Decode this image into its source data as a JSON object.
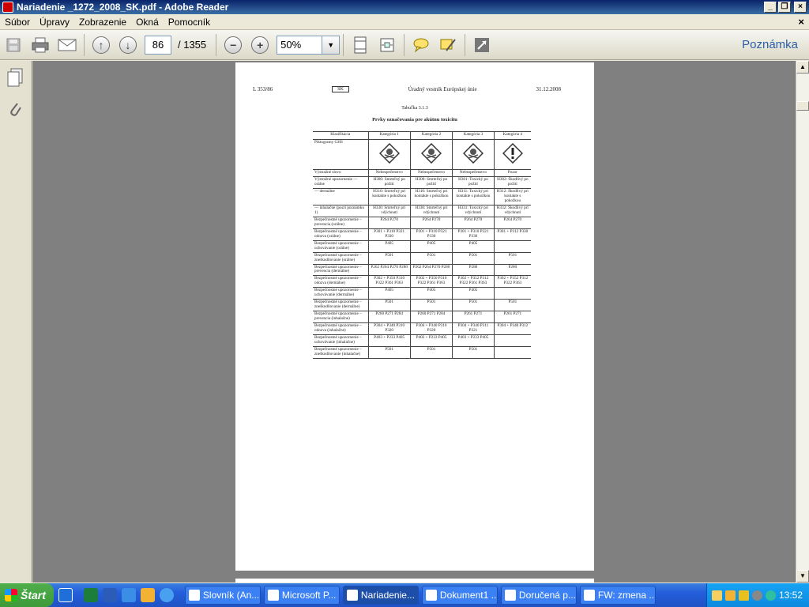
{
  "window": {
    "title": "Nariadenie _1272_2008_SK.pdf - Adobe Reader"
  },
  "menu": {
    "items": [
      "Súbor",
      "Úpravy",
      "Zobrazenie",
      "Okná",
      "Pomocník"
    ],
    "close": "×"
  },
  "toolbar": {
    "page_current": "86",
    "page_total": "/ 1355",
    "zoom": "50%",
    "zoom_dropdown": "▼",
    "comment_label": "Poznámka"
  },
  "doc": {
    "header_left": "L 353/86",
    "header_lang": "SK",
    "header_center": "Úradný vestník Európskej únie",
    "header_right": "31.12.2008",
    "table_title": "Tabuľka 3.1.3",
    "table_subtitle": "Prvky označovania pre akútnu toxicitu",
    "columns": [
      "Klasifikácia",
      "Kategória 1",
      "Kategória 2",
      "Kategória 3",
      "Kategória 4"
    ],
    "rows": [
      {
        "label": "Piktogramy GHS",
        "cells": [
          "skull",
          "skull",
          "skull",
          "excl"
        ]
      },
      {
        "label": "Výstražné slovo",
        "cells": [
          "Nebezpečenstvo",
          "Nebezpečenstvo",
          "Nebezpečenstvo",
          "Pozor"
        ]
      },
      {
        "label": "Výstražné upozornenie — orálne",
        "cells": [
          "H300: Smrteľný po požití",
          "H300: Smrteľný po požití",
          "H301: Toxický po požití",
          "H302: Škodlivý po požití"
        ]
      },
      {
        "label": "— dermálne",
        "cells": [
          "H310: Smrteľný pri kontakte s pokožkou",
          "H310: Smrteľný pri kontakte s pokožkou",
          "H311: Toxický pri kontakte s pokožkou",
          "H312: Škodlivý pri kontakte s pokožkou"
        ]
      },
      {
        "label": "— inhalačne (pozri poznámku 1)",
        "cells": [
          "H330: Smrteľný pri vdýchnutí",
          "H330: Smrteľný pri vdýchnutí",
          "H331: Toxický pri vdýchnutí",
          "H332: Škodlivý pri vdýchnutí"
        ]
      },
      {
        "label": "Bezpečnostné upozornenie – prevencia (orálne)",
        "cells": [
          "P264 P270",
          "P264 P270",
          "P264 P270",
          "P264 P270"
        ]
      },
      {
        "label": "Bezpečnostné upozornenie – odozva (orálne)",
        "cells": [
          "P301 + P310 P321 P330",
          "P301 + P310 P321 P330",
          "P301 + P310 P321 P330",
          "P301 + P312 P330"
        ]
      },
      {
        "label": "Bezpečnostné upozornenie – uchovávanie (orálne)",
        "cells": [
          "P405",
          "P405",
          "P405",
          ""
        ]
      },
      {
        "label": "Bezpečnostné upozornenie – zneškodňovanie (orálne)",
        "cells": [
          "P501",
          "P501",
          "P501",
          "P501"
        ]
      },
      {
        "label": "Bezpečnostné upozornenie – prevencia (dermálne)",
        "cells": [
          "P262 P264 P270 P280",
          "P262 P264 P270 P280",
          "P280",
          "P280"
        ]
      },
      {
        "label": "Bezpečnostné upozornenie – odozva (dermálne)",
        "cells": [
          "P302 + P350 P310 P322 P361 P363",
          "P302 + P350 P310 P322 P361 P363",
          "P302 + P352 P312 P322 P361 P363",
          "P302 + P352 P312 P322 P363"
        ]
      },
      {
        "label": "Bezpečnostné upozornenie – uchovávanie (dermálne)",
        "cells": [
          "P405",
          "P405",
          "P405",
          ""
        ]
      },
      {
        "label": "Bezpečnostné upozornenie – zneškodňovanie (dermálne)",
        "cells": [
          "P501",
          "P501",
          "P501",
          "P501"
        ]
      },
      {
        "label": "Bezpečnostné upozornenie – prevencia (inhalačne)",
        "cells": [
          "P260 P271 P284",
          "P260 P271 P284",
          "P261 P271",
          "P261 P271"
        ]
      },
      {
        "label": "Bezpečnostné upozornenie – odozva (inhalačne)",
        "cells": [
          "P304 + P340 P310 P320",
          "P304 + P340 P310 P320",
          "P304 + P340 P311 P321",
          "P304 + P340 P312"
        ]
      },
      {
        "label": "Bezpečnostné upozornenie – uchovávanie (inhalačne)",
        "cells": [
          "P403 + P233 P405",
          "P403 + P233 P405",
          "P403 + P233 P405",
          ""
        ]
      },
      {
        "label": "Bezpečnostné upozornenie – zneškodňovanie (inhalačne)",
        "cells": [
          "P501",
          "P501",
          "P501",
          ""
        ]
      }
    ]
  },
  "taskbar": {
    "start": "Štart",
    "tasks": [
      "Slovník (An...",
      "Microsoft P...",
      "Nariadenie...",
      "Dokument1 ...",
      "Doručená p...",
      "FW: zmena ..."
    ],
    "clock": "13:52"
  }
}
